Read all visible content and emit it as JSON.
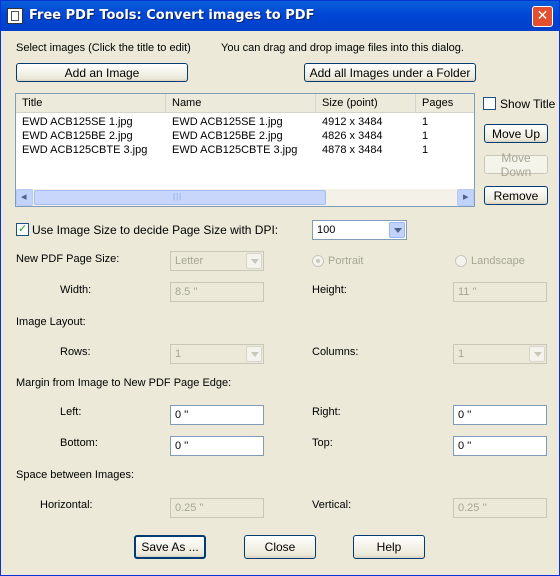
{
  "window": {
    "title": "Free PDF Tools: Convert images to PDF",
    "close_glyph": "✕"
  },
  "top": {
    "select_label": "Select images (Click the title to edit)",
    "drag_hint": "You can drag and drop image files into this dialog.",
    "add_image": "Add an Image",
    "add_folder": "Add all Images under a Folder"
  },
  "list": {
    "columns": [
      "Title",
      "Name",
      "Size (point)",
      "Pages"
    ],
    "rows": [
      {
        "title": "EWD ACB125SE 1.jpg",
        "name": "EWD ACB125SE 1.jpg",
        "size": "4912 x 3484",
        "pages": "1"
      },
      {
        "title": "EWD ACB125BE 2.jpg",
        "name": "EWD ACB125BE 2.jpg",
        "size": "4826 x 3484",
        "pages": "1"
      },
      {
        "title": "EWD ACB125CBTE 3.jpg",
        "name": "EWD ACB125CBTE 3.jpg",
        "size": "4878 x 3484",
        "pages": "1"
      }
    ],
    "scroll_left": "◂",
    "scroll_right": "▸",
    "grip": "|||"
  },
  "side": {
    "show_title": "Show Title",
    "move_up": "Move Up",
    "move_down": "Move Down",
    "remove": "Remove"
  },
  "options": {
    "use_image_size": "Use Image Size to decide Page Size with DPI:",
    "dpi": "100",
    "page_size_label": "New PDF Page Size:",
    "page_size": "Letter",
    "portrait": "Portrait",
    "landscape": "Landscape",
    "width_label": "Width:",
    "width": "8.5 ''",
    "height_label": "Height:",
    "height": "11 ''",
    "layout_label": "Image Layout:",
    "rows_label": "Rows:",
    "rows": "1",
    "columns_label": "Columns:",
    "columns": "1",
    "margin_label": "Margin from Image to New PDF Page Edge:",
    "left_label": "Left:",
    "left": "0 ''",
    "right_label": "Right:",
    "right": "0 ''",
    "bottom_label": "Bottom:",
    "bottom": "0 ''",
    "top_label": "Top:",
    "top": "0 ''",
    "space_label": "Space between Images:",
    "horizontal_label": "Horizontal:",
    "horizontal": "0.25 ''",
    "vertical_label": "Vertical:",
    "vertical": "0.25 ''"
  },
  "footer": {
    "save_as": "Save As ...",
    "close": "Close",
    "help": "Help"
  }
}
